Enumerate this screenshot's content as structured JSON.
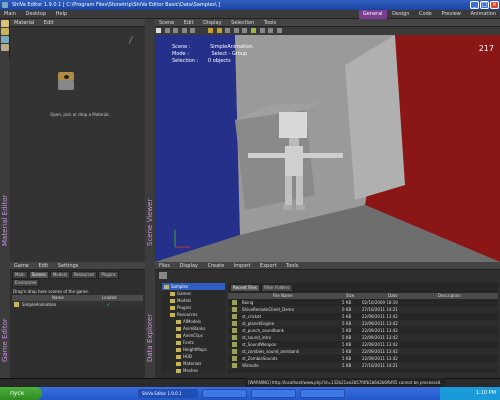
{
  "window": {
    "title": "ShiVa Editor 1.9.0.1 [ C:\\Program Files\\Stonetrip\\ShiVa Editor Basic\\Data\\Samples\\ ]"
  },
  "menu": {
    "items": [
      "Main",
      "Desktop",
      "Help"
    ]
  },
  "modes": [
    "General",
    "Design",
    "Code",
    "Preview",
    "Animation"
  ],
  "material_editor": {
    "vertical_label": "Material Editor",
    "menu": [
      "Material",
      "Edit"
    ],
    "hint": "Open, pick or drop a Material."
  },
  "scene_viewer": {
    "vertical_label": "Scene Viewer",
    "menu": [
      "Scene",
      "Edit",
      "Display",
      "Selection",
      "Tools"
    ],
    "info": {
      "scene_label": "Scene :",
      "scene_value": "SimpleAnimation",
      "mode_label": "Mode :",
      "mode_value": "Select - Group",
      "selection_label": "Selection :",
      "selection_value": "0 objects"
    },
    "fps": "217"
  },
  "game_editor": {
    "vertical_label": "Game Editor",
    "menu": [
      "Game",
      "Edit",
      "Settings"
    ],
    "tabs": [
      "Main",
      "Scenes",
      "Models",
      "Resources",
      "Plugins",
      "Environme"
    ],
    "hint": "Drag'n drop here scenes of the game.",
    "columns": [
      "Name",
      "Loaded"
    ],
    "rows": [
      {
        "name": "SimpleAnimation",
        "loaded": "✔"
      }
    ]
  },
  "data_explorer": {
    "vertical_label": "Data Explorer",
    "menu": [
      "Files",
      "Display",
      "Create",
      "Import",
      "Export",
      "Tools"
    ],
    "tree": [
      {
        "label": "Samples",
        "depth": 0,
        "selected": true
      },
      {
        "label": "Games",
        "depth": 1
      },
      {
        "label": "Models",
        "depth": 1
      },
      {
        "label": "Plugins",
        "depth": 1
      },
      {
        "label": "Resources",
        "depth": 1
      },
      {
        "label": "AIModels",
        "depth": 2
      },
      {
        "label": "AnimBanks",
        "depth": 2
      },
      {
        "label": "AnimClips",
        "depth": 2
      },
      {
        "label": "Fonts",
        "depth": 2
      },
      {
        "label": "HeightMaps",
        "depth": 2
      },
      {
        "label": "HUD",
        "depth": 2
      },
      {
        "label": "Materials",
        "depth": 2
      },
      {
        "label": "Meshes",
        "depth": 2
      }
    ],
    "filetabs": [
      "Recent Files",
      "Filter Folders"
    ],
    "columns": [
      "File Name",
      "Size",
      "Date",
      "Description"
    ],
    "files": [
      {
        "name": "Boing",
        "size": "5 KB",
        "date": "02/10/2009 18:19"
      },
      {
        "name": "ShivaRemoteClient_Demo",
        "size": "0 KB",
        "date": "27/10/2011 14:21"
      },
      {
        "name": "st_cricket",
        "size": "5 KB",
        "date": "22/09/2011 13:42"
      },
      {
        "name": "st_planetEngine",
        "size": "5 KB",
        "date": "22/09/2011 13:42"
      },
      {
        "name": "st_punch_soundbank",
        "size": "5 KB",
        "date": "22/09/2011 13:42"
      },
      {
        "name": "st_sound_intro",
        "size": "5 KB",
        "date": "22/09/2011 13:42"
      },
      {
        "name": "st_SoundWeapon",
        "size": "5 KB",
        "date": "22/09/2011 13:42"
      },
      {
        "name": "st_zombies_sound_anmbank",
        "size": "5 KB",
        "date": "22/09/2011 13:42"
      },
      {
        "name": "st_ZombieSounds",
        "size": "5 KB",
        "date": "22/09/2011 13:42"
      },
      {
        "name": "Wireuite",
        "size": "5 KB",
        "date": "27/10/2011 14:21"
      }
    ]
  },
  "status": {
    "warning": "[WARNING] http://localhost/www.php?id=132b21ae2b57f4fb1b6d2b6fbf05 cannot be processed."
  },
  "taskbar": {
    "start": "пуск",
    "tasks": [
      "ShiVa Editor 1.9.0.1",
      "",
      "",
      ""
    ],
    "tray_time": "1:10 PM"
  },
  "colors": {
    "accent": "#7a3c8e",
    "taskbar": "#2356c8",
    "start": "#2f8b24"
  }
}
